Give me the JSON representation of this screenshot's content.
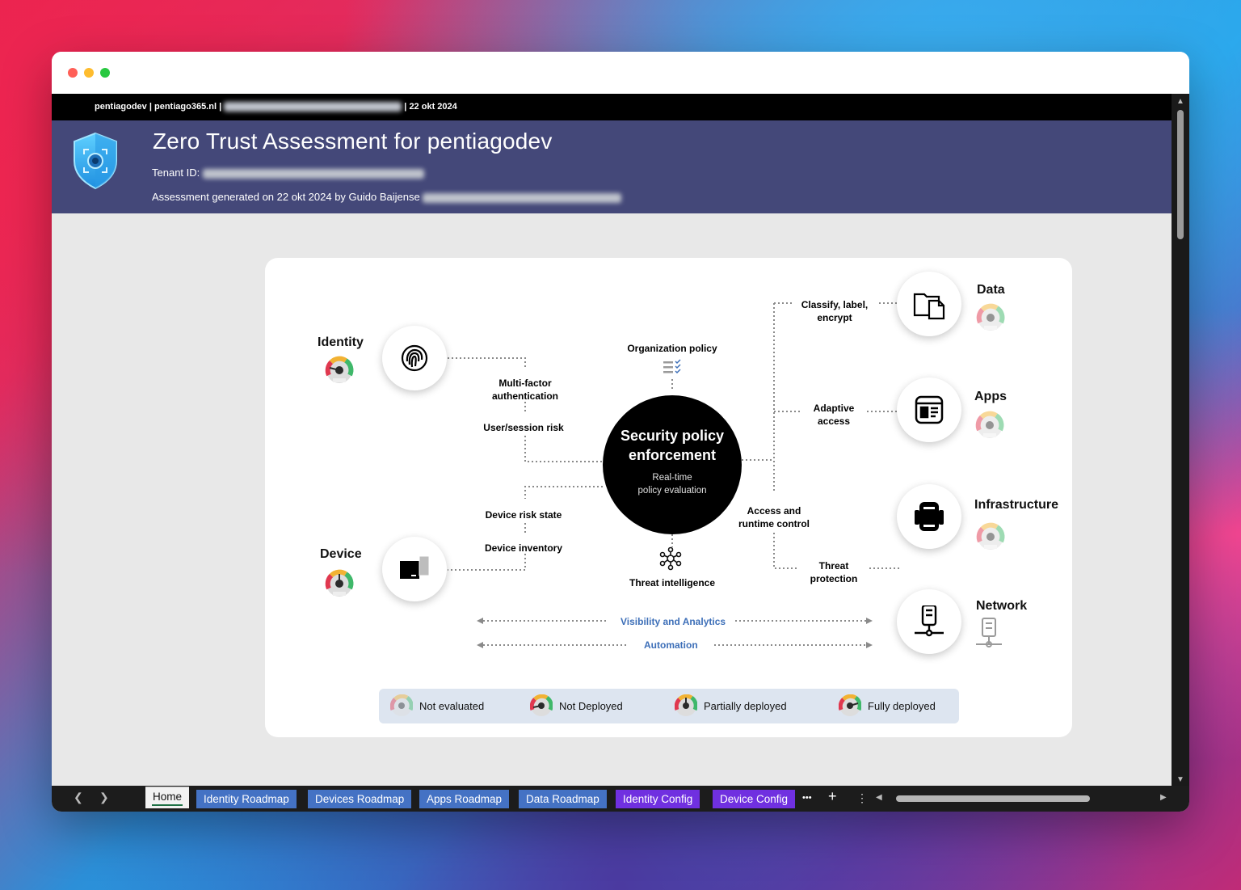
{
  "topbar": {
    "org": "pentiagodev",
    "domain": "pentiago365.nl",
    "sep": "|",
    "date": "22 okt 2024"
  },
  "header": {
    "title": "Zero Trust Assessment for pentiagodev",
    "tenant_label": "Tenant ID:",
    "generated": "Assessment generated on 22 okt 2024 by Guido Baijense"
  },
  "diagram": {
    "center_title_1": "Security policy",
    "center_title_2": "enforcement",
    "center_sub_1": "Real-time",
    "center_sub_2": "policy evaluation",
    "pillars": {
      "identity": "Identity",
      "device": "Device",
      "data": "Data",
      "apps": "Apps",
      "infrastructure": "Infrastructure",
      "network": "Network"
    },
    "labels": {
      "org_policy": "Organization policy",
      "mfa_1": "Multi-factor",
      "mfa_2": "authentication",
      "user_risk": "User/session risk",
      "device_risk": "Device risk state",
      "device_inventory": "Device inventory",
      "threat_intel": "Threat intelligence",
      "classify_1": "Classify, label,",
      "classify_2": "encrypt",
      "adaptive_1": "Adaptive",
      "adaptive_2": "access",
      "access_1": "Access and",
      "access_2": "runtime control",
      "threat_prot_1": "Threat",
      "threat_prot_2": "protection",
      "visibility": "Visibility and Analytics",
      "automation": "Automation"
    }
  },
  "legend": [
    {
      "label": "Not evaluated",
      "status": "not-evaluated"
    },
    {
      "label": "Not Deployed",
      "status": "not-deployed"
    },
    {
      "label": "Partially deployed",
      "status": "partially-deployed"
    },
    {
      "label": "Fully deployed",
      "status": "fully-deployed"
    }
  ],
  "tabs": {
    "home": "Home",
    "identity_roadmap": "Identity Roadmap",
    "devices_roadmap": "Devices Roadmap",
    "apps_roadmap": "Apps Roadmap",
    "data_roadmap": "Data Roadmap",
    "identity_config": "Identity Config",
    "device_config": "Device Config",
    "more": "•••",
    "add": "+",
    "options": "⋮"
  },
  "colors": {
    "header_bg": "#444879",
    "tab_blue": "#4472c4",
    "tab_purple": "#7030e0",
    "link_blue": "#3d6fb8"
  }
}
